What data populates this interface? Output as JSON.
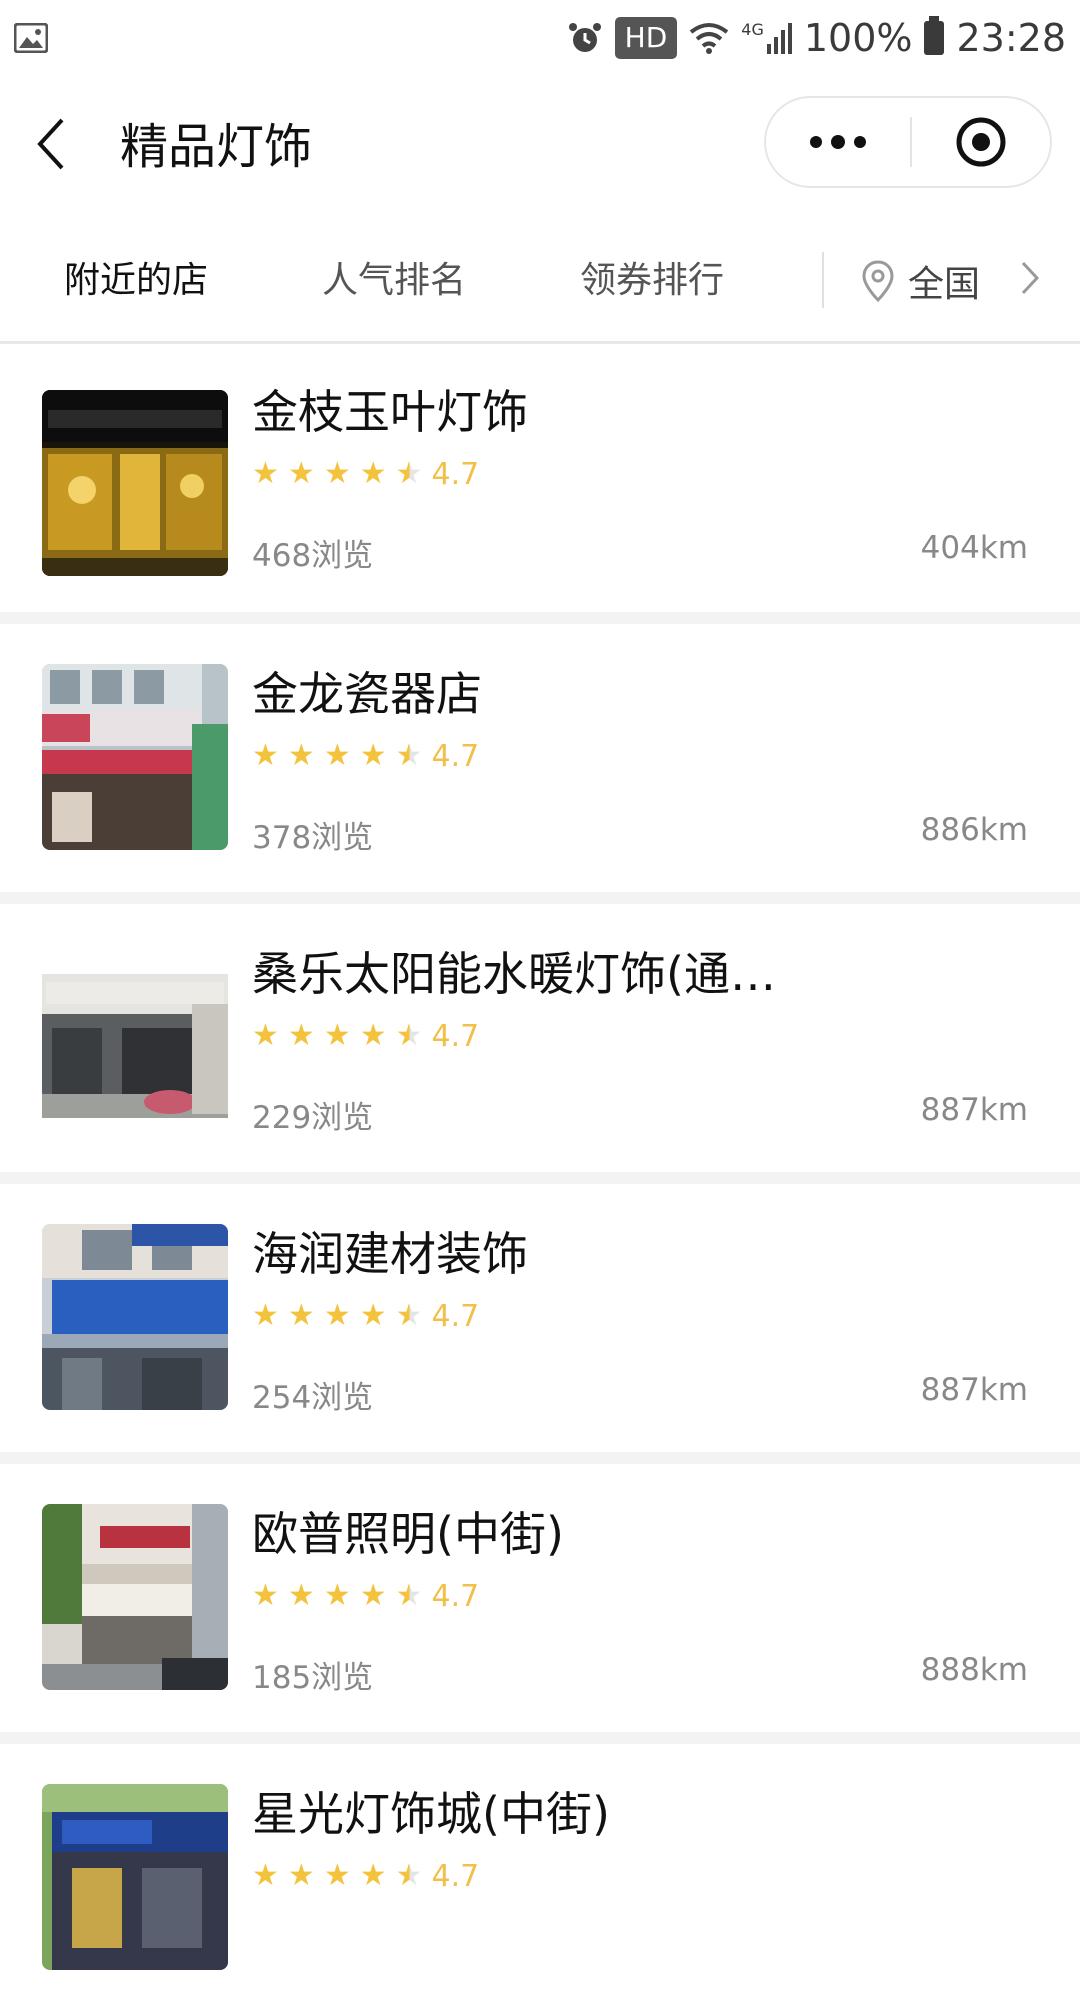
{
  "status_bar": {
    "hd": "HD",
    "network": "4G",
    "battery": "100%",
    "time": "23:28"
  },
  "header": {
    "title": "精品灯饰"
  },
  "tabs": [
    {
      "label": "附近的店"
    },
    {
      "label": "人气排名"
    },
    {
      "label": "领券排行"
    }
  ],
  "location": {
    "label": "全国"
  },
  "stores": [
    {
      "name": "金枝玉叶灯饰",
      "rating": "4.7",
      "views": "468浏览",
      "distance": "404km"
    },
    {
      "name": "金龙瓷器店",
      "rating": "4.7",
      "views": "378浏览",
      "distance": "886km"
    },
    {
      "name": "桑乐太阳能水暖灯饰(通…",
      "rating": "4.7",
      "views": "229浏览",
      "distance": "887km"
    },
    {
      "name": "海润建材装饰",
      "rating": "4.7",
      "views": "254浏览",
      "distance": "887km"
    },
    {
      "name": "欧普照明(中街)",
      "rating": "4.7",
      "views": "185浏览",
      "distance": "888km"
    },
    {
      "name": "星光灯饰城(中街)",
      "rating": "4.7",
      "views": "",
      "distance": ""
    }
  ],
  "colors": {
    "star": "#f4c33e",
    "secondary_text": "#888888",
    "separator": "#f3f3f3"
  }
}
